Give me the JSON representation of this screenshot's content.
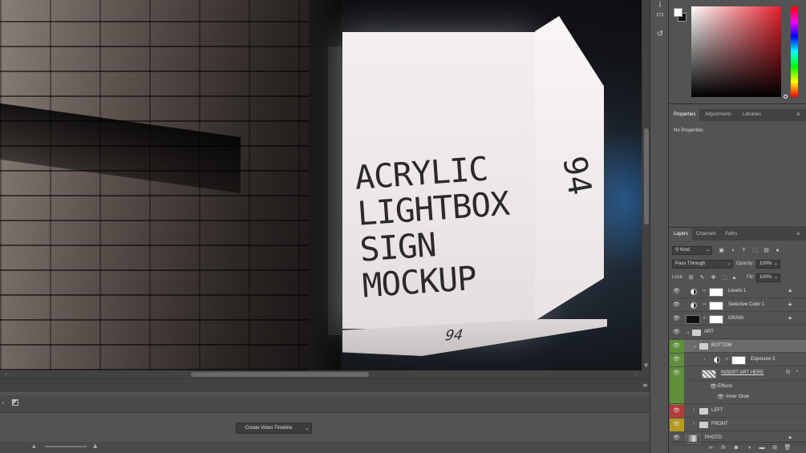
{
  "colors": {
    "panel_bg": "#535353",
    "dark_bg": "#424242",
    "eye_green": "#5e8f3a",
    "eye_red": "#b23c3c",
    "eye_yellow": "#b59a1e"
  },
  "canvas": {
    "sign_lines": [
      "ACRYLIC",
      "LIGHTBOX",
      "SIGN",
      "MOCKUP"
    ],
    "side_number": "94",
    "bottom_number": "94"
  },
  "timeline": {
    "create_button": "Create Video Timeline"
  },
  "properties": {
    "tabs": [
      "Properties",
      "Adjustments",
      "Libraries"
    ],
    "message": "No Properties"
  },
  "layers_panel": {
    "tabs": [
      "Layers",
      "Channels",
      "Paths"
    ],
    "filter_kind": "Kind",
    "blend_mode": "Pass Through",
    "opacity_label": "Opacity:",
    "opacity_value": "100%",
    "lock_label": "Lock:",
    "fill_label": "Fill:",
    "fill_value": "100%",
    "layers": [
      {
        "name": "Levels 1",
        "type": "adjustment",
        "locked": true
      },
      {
        "name": "Selective Color 1",
        "type": "adjustment",
        "locked": true
      },
      {
        "name": "GRAIN",
        "type": "pixel",
        "locked": true
      },
      {
        "name": "ART",
        "type": "group"
      },
      {
        "name": "BOTTOM",
        "type": "group"
      },
      {
        "name": "Exposure 3",
        "type": "adjustment"
      },
      {
        "name": "INSERT ART HERE",
        "type": "smart"
      },
      {
        "name": "Effects",
        "type": "effects"
      },
      {
        "name": "Inner Glow",
        "type": "effect"
      },
      {
        "name": "LEFT",
        "type": "group"
      },
      {
        "name": "FRONT",
        "type": "group"
      },
      {
        "name": "PHOTO",
        "type": "pixel",
        "locked": true
      }
    ],
    "fx_label": "fx"
  }
}
